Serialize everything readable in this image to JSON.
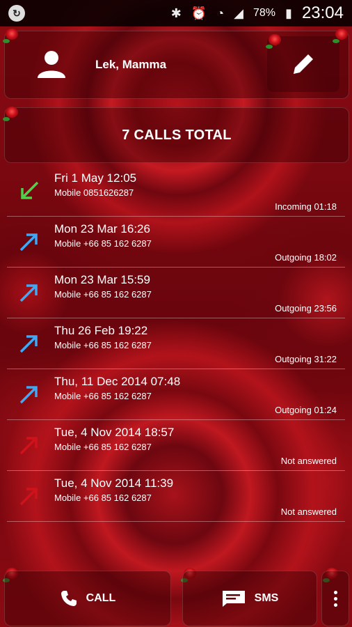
{
  "status_bar": {
    "battery": "78%",
    "time": "23:04"
  },
  "contact": {
    "name": "Lek, Mamma"
  },
  "summary": {
    "total_label": "7 CALLS TOTAL"
  },
  "calls": [
    {
      "date": "Fri 1 May 12:05",
      "number": "Mobile 0851626287",
      "status": "Incoming 01:18",
      "type": "incoming"
    },
    {
      "date": "Mon 23 Mar 16:26",
      "number": "Mobile +66 85 162 6287",
      "status": "Outgoing 18:02",
      "type": "outgoing"
    },
    {
      "date": "Mon 23 Mar 15:59",
      "number": "Mobile +66 85 162 6287",
      "status": "Outgoing 23:56",
      "type": "outgoing"
    },
    {
      "date": "Thu 26 Feb 19:22",
      "number": "Mobile +66 85 162 6287",
      "status": "Outgoing 31:22",
      "type": "outgoing"
    },
    {
      "date": "Thu, 11 Dec 2014 07:48",
      "number": "Mobile +66 85 162 6287",
      "status": "Outgoing 01:24",
      "type": "outgoing"
    },
    {
      "date": "Tue, 4 Nov 2014 18:57",
      "number": "Mobile +66 85 162 6287",
      "status": "Not answered",
      "type": "missed"
    },
    {
      "date": "Tue, 4 Nov 2014 11:39",
      "number": "Mobile +66 85 162 6287",
      "status": "Not answered",
      "type": "missed"
    }
  ],
  "actions": {
    "call_label": "CALL",
    "sms_label": "SMS"
  },
  "colors": {
    "incoming": "#4cd34c",
    "outgoing": "#3fa9f5",
    "missed": "#d0121b"
  }
}
